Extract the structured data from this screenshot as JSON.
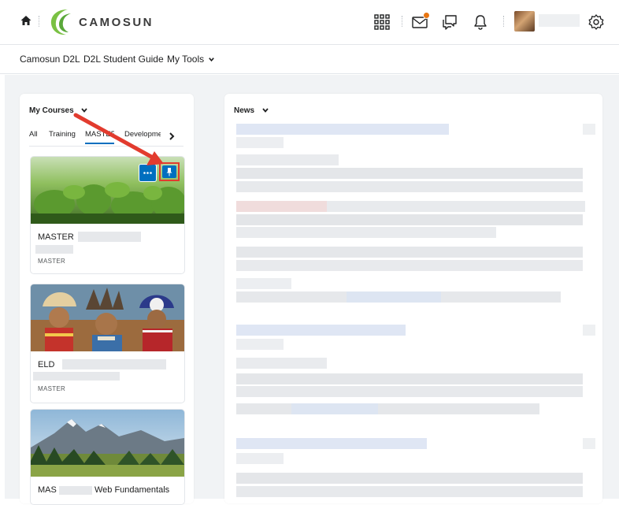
{
  "brand": {
    "logo_text": "CAMOSUN"
  },
  "nav": {
    "links": [
      "Camosun D2L",
      "D2L Student Guide",
      "My Tools"
    ]
  },
  "courses_widget": {
    "title": "My Courses",
    "tabs": [
      "All",
      "Training",
      "MASTER",
      "Developme"
    ],
    "active_tab": "MASTER",
    "cards": [
      {
        "title": "MASTER",
        "subtitle": "MASTER"
      },
      {
        "title": "ELD",
        "subtitle": "MASTER"
      },
      {
        "title_prefix": "MAS",
        "title_suffix": "Web Fundamentals"
      }
    ]
  },
  "news_widget": {
    "title": "News"
  },
  "colors": {
    "accent": "#006fbf",
    "annotation": "#e23b2e",
    "notification_badge": "#e87511",
    "logo_green": "#7ac143"
  },
  "icons": [
    "home-icon",
    "grid-icon",
    "mail-icon",
    "chat-icon",
    "bell-icon",
    "gear-icon",
    "chevron-down-icon",
    "chevron-right-icon",
    "more-icon",
    "pin-icon"
  ]
}
